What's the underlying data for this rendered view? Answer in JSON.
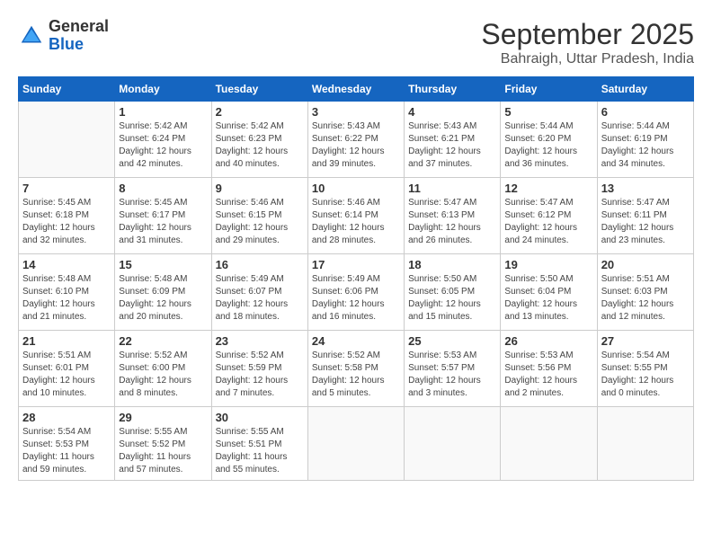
{
  "logo": {
    "text_general": "General",
    "text_blue": "Blue"
  },
  "title": "September 2025",
  "location": "Bahraigh, Uttar Pradesh, India",
  "days_of_week": [
    "Sunday",
    "Monday",
    "Tuesday",
    "Wednesday",
    "Thursday",
    "Friday",
    "Saturday"
  ],
  "weeks": [
    [
      {
        "day": "",
        "info": ""
      },
      {
        "day": "1",
        "info": "Sunrise: 5:42 AM\nSunset: 6:24 PM\nDaylight: 12 hours\nand 42 minutes."
      },
      {
        "day": "2",
        "info": "Sunrise: 5:42 AM\nSunset: 6:23 PM\nDaylight: 12 hours\nand 40 minutes."
      },
      {
        "day": "3",
        "info": "Sunrise: 5:43 AM\nSunset: 6:22 PM\nDaylight: 12 hours\nand 39 minutes."
      },
      {
        "day": "4",
        "info": "Sunrise: 5:43 AM\nSunset: 6:21 PM\nDaylight: 12 hours\nand 37 minutes."
      },
      {
        "day": "5",
        "info": "Sunrise: 5:44 AM\nSunset: 6:20 PM\nDaylight: 12 hours\nand 36 minutes."
      },
      {
        "day": "6",
        "info": "Sunrise: 5:44 AM\nSunset: 6:19 PM\nDaylight: 12 hours\nand 34 minutes."
      }
    ],
    [
      {
        "day": "7",
        "info": "Sunrise: 5:45 AM\nSunset: 6:18 PM\nDaylight: 12 hours\nand 32 minutes."
      },
      {
        "day": "8",
        "info": "Sunrise: 5:45 AM\nSunset: 6:17 PM\nDaylight: 12 hours\nand 31 minutes."
      },
      {
        "day": "9",
        "info": "Sunrise: 5:46 AM\nSunset: 6:15 PM\nDaylight: 12 hours\nand 29 minutes."
      },
      {
        "day": "10",
        "info": "Sunrise: 5:46 AM\nSunset: 6:14 PM\nDaylight: 12 hours\nand 28 minutes."
      },
      {
        "day": "11",
        "info": "Sunrise: 5:47 AM\nSunset: 6:13 PM\nDaylight: 12 hours\nand 26 minutes."
      },
      {
        "day": "12",
        "info": "Sunrise: 5:47 AM\nSunset: 6:12 PM\nDaylight: 12 hours\nand 24 minutes."
      },
      {
        "day": "13",
        "info": "Sunrise: 5:47 AM\nSunset: 6:11 PM\nDaylight: 12 hours\nand 23 minutes."
      }
    ],
    [
      {
        "day": "14",
        "info": "Sunrise: 5:48 AM\nSunset: 6:10 PM\nDaylight: 12 hours\nand 21 minutes."
      },
      {
        "day": "15",
        "info": "Sunrise: 5:48 AM\nSunset: 6:09 PM\nDaylight: 12 hours\nand 20 minutes."
      },
      {
        "day": "16",
        "info": "Sunrise: 5:49 AM\nSunset: 6:07 PM\nDaylight: 12 hours\nand 18 minutes."
      },
      {
        "day": "17",
        "info": "Sunrise: 5:49 AM\nSunset: 6:06 PM\nDaylight: 12 hours\nand 16 minutes."
      },
      {
        "day": "18",
        "info": "Sunrise: 5:50 AM\nSunset: 6:05 PM\nDaylight: 12 hours\nand 15 minutes."
      },
      {
        "day": "19",
        "info": "Sunrise: 5:50 AM\nSunset: 6:04 PM\nDaylight: 12 hours\nand 13 minutes."
      },
      {
        "day": "20",
        "info": "Sunrise: 5:51 AM\nSunset: 6:03 PM\nDaylight: 12 hours\nand 12 minutes."
      }
    ],
    [
      {
        "day": "21",
        "info": "Sunrise: 5:51 AM\nSunset: 6:01 PM\nDaylight: 12 hours\nand 10 minutes."
      },
      {
        "day": "22",
        "info": "Sunrise: 5:52 AM\nSunset: 6:00 PM\nDaylight: 12 hours\nand 8 minutes."
      },
      {
        "day": "23",
        "info": "Sunrise: 5:52 AM\nSunset: 5:59 PM\nDaylight: 12 hours\nand 7 minutes."
      },
      {
        "day": "24",
        "info": "Sunrise: 5:52 AM\nSunset: 5:58 PM\nDaylight: 12 hours\nand 5 minutes."
      },
      {
        "day": "25",
        "info": "Sunrise: 5:53 AM\nSunset: 5:57 PM\nDaylight: 12 hours\nand 3 minutes."
      },
      {
        "day": "26",
        "info": "Sunrise: 5:53 AM\nSunset: 5:56 PM\nDaylight: 12 hours\nand 2 minutes."
      },
      {
        "day": "27",
        "info": "Sunrise: 5:54 AM\nSunset: 5:55 PM\nDaylight: 12 hours\nand 0 minutes."
      }
    ],
    [
      {
        "day": "28",
        "info": "Sunrise: 5:54 AM\nSunset: 5:53 PM\nDaylight: 11 hours\nand 59 minutes."
      },
      {
        "day": "29",
        "info": "Sunrise: 5:55 AM\nSunset: 5:52 PM\nDaylight: 11 hours\nand 57 minutes."
      },
      {
        "day": "30",
        "info": "Sunrise: 5:55 AM\nSunset: 5:51 PM\nDaylight: 11 hours\nand 55 minutes."
      },
      {
        "day": "",
        "info": ""
      },
      {
        "day": "",
        "info": ""
      },
      {
        "day": "",
        "info": ""
      },
      {
        "day": "",
        "info": ""
      }
    ]
  ]
}
